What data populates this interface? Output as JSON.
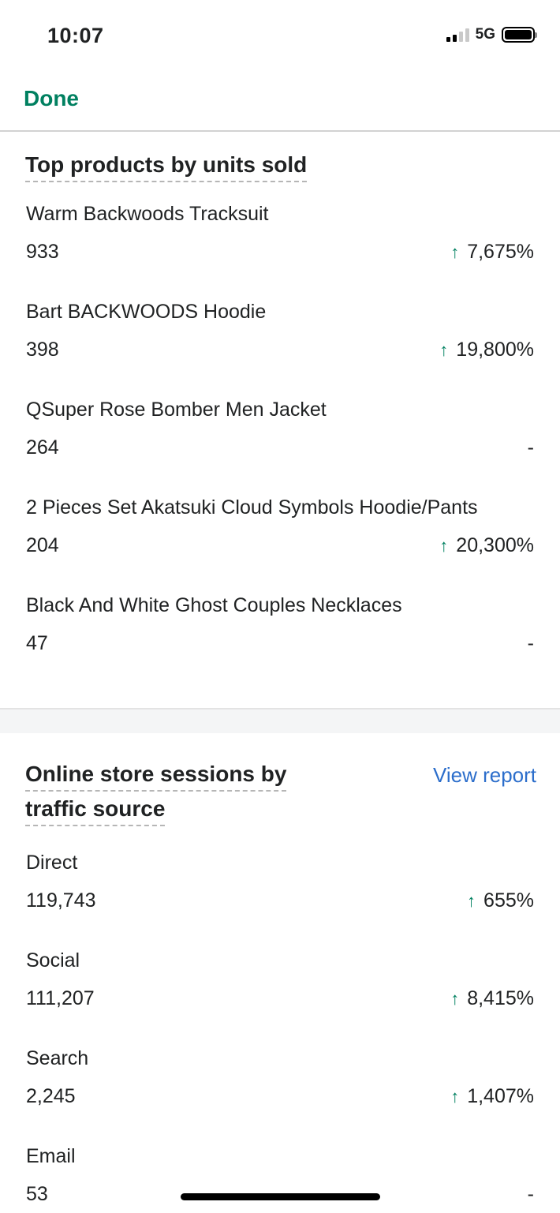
{
  "status_bar": {
    "time": "10:07",
    "network": "5G",
    "signal_bars_active": 2,
    "signal_bars_total": 4,
    "battery_level": 1.0
  },
  "nav": {
    "done_label": "Done"
  },
  "colors": {
    "accent_green": "#008060",
    "link_blue": "#2c6ecb"
  },
  "top_products": {
    "title": "Top products by units sold",
    "items": [
      {
        "name": "Warm Backwoods Tracksuit",
        "value": "933",
        "change": "7,675%",
        "trend": "up"
      },
      {
        "name": "Bart BACKWOODS Hoodie",
        "value": "398",
        "change": "19,800%",
        "trend": "up"
      },
      {
        "name": "QSuper Rose Bomber Men Jacket",
        "value": "264",
        "change": "-",
        "trend": "none"
      },
      {
        "name": "2 Pieces Set Akatsuki Cloud Symbols Hoodie/Pants",
        "value": "204",
        "change": "20,300%",
        "trend": "up"
      },
      {
        "name": "Black And White Ghost Couples Necklaces",
        "value": "47",
        "change": "-",
        "trend": "none"
      }
    ]
  },
  "sessions": {
    "title_line1": "Online store sessions by",
    "title_line2": "traffic source",
    "view_report_label": "View report",
    "items": [
      {
        "name": "Direct",
        "value": "119,743",
        "change": "655%",
        "trend": "up"
      },
      {
        "name": "Social",
        "value": "111,207",
        "change": "8,415%",
        "trend": "up"
      },
      {
        "name": "Search",
        "value": "2,245",
        "change": "1,407%",
        "trend": "up"
      },
      {
        "name": "Email",
        "value": "53",
        "change": "-",
        "trend": "none"
      }
    ]
  },
  "icons": {
    "trend_up": "↑"
  }
}
